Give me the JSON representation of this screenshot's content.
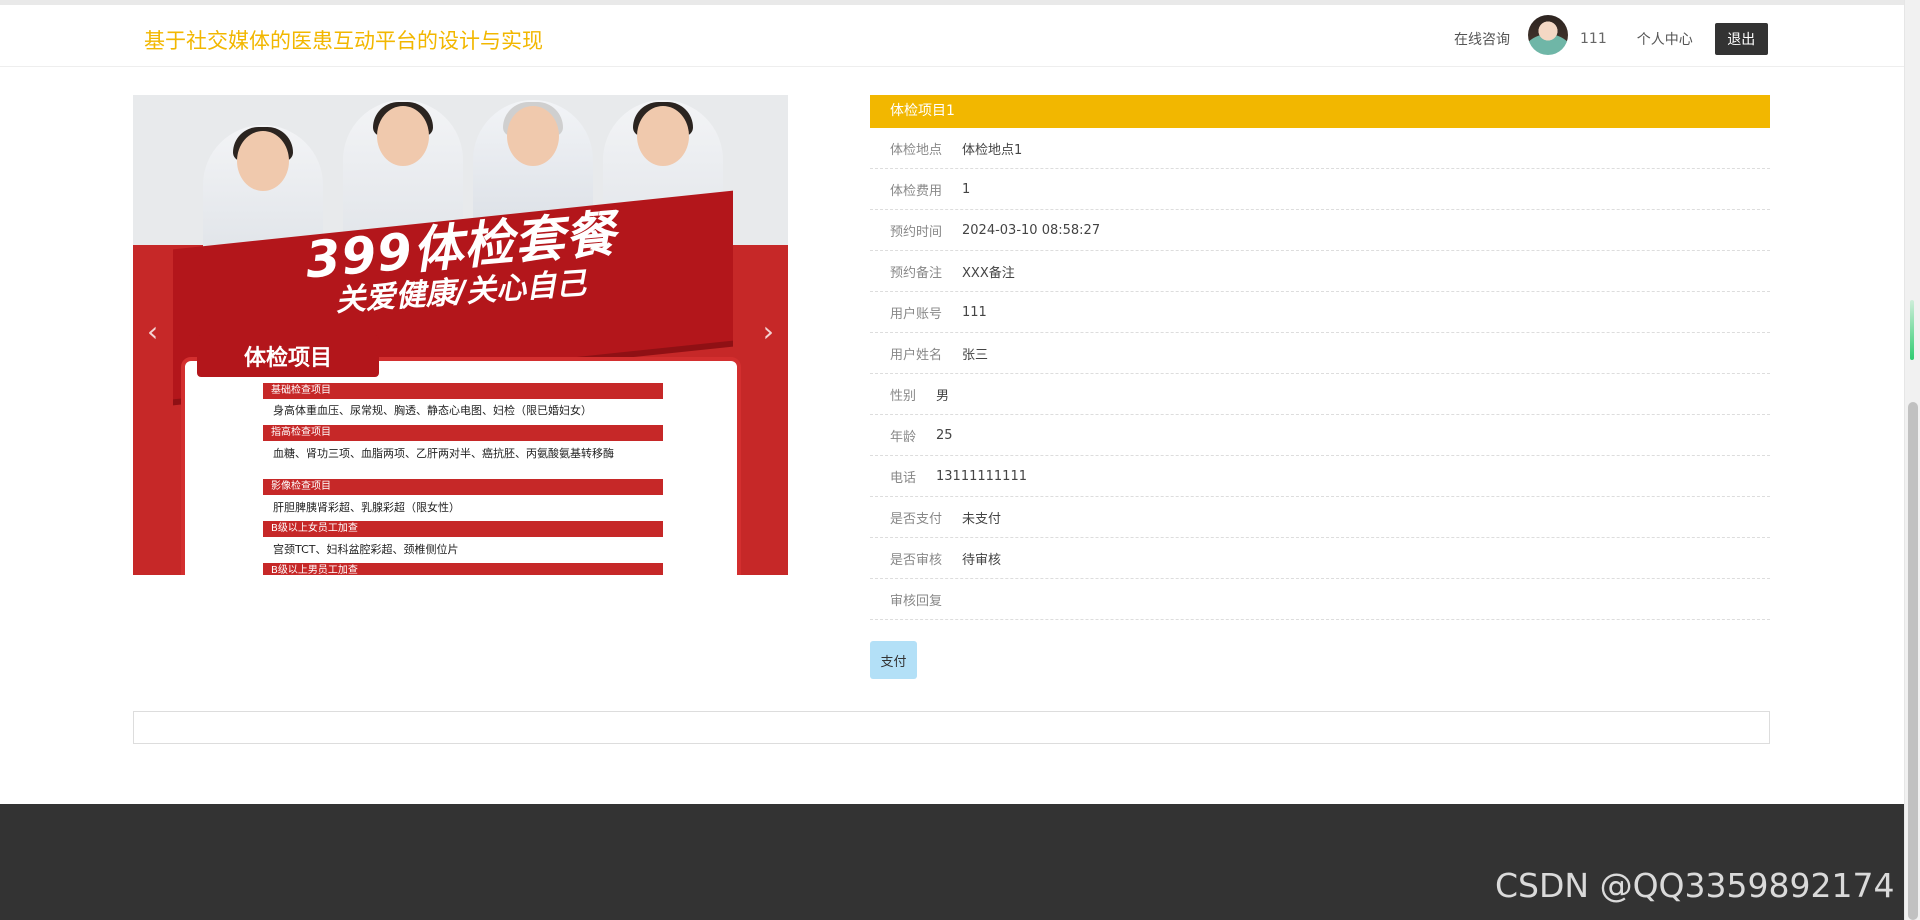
{
  "header": {
    "site_title": "基于社交媒体的医患互动平台的设计与实现",
    "nav": {
      "consult": "在线咨询",
      "username": "111",
      "profile": "个人中心",
      "logout": "退出"
    }
  },
  "carousel": {
    "poster_title": "399体检套餐",
    "poster_subtitle": "关爱健康/关心自己",
    "card_tab": "体检项目",
    "sections": [
      {
        "title": "基础检查项目",
        "content": "身高体重血压、尿常规、胸透、静态心电图、妇检（限已婚妇女）"
      },
      {
        "title": "指高检查项目",
        "content": "血糖、肾功三项、血脂两项、乙肝两对半、癌抗胚、丙氨酸氨基转移酶"
      },
      {
        "title": "影像检查项目",
        "content": "肝胆脾胰肾彩超、乳腺彩超（限女性）"
      },
      {
        "title": "B级以上女员工加查",
        "content": "宫颈TCT、妇科盆腔彩超、颈椎侧位片"
      },
      {
        "title": "B级以上男员工加查",
        "content": ""
      }
    ],
    "prev_icon": "‹",
    "next_icon": "›"
  },
  "detail": {
    "title": "体检项目1",
    "rows": [
      {
        "label": "体检地点",
        "value": "体检地点1"
      },
      {
        "label": "体检费用",
        "value": "1"
      },
      {
        "label": "预约时间",
        "value": "2024-03-10 08:58:27"
      },
      {
        "label": "预约备注",
        "value": "XXX备注"
      },
      {
        "label": "用户账号",
        "value": "111"
      },
      {
        "label": "用户姓名",
        "value": "张三"
      },
      {
        "label": "性别",
        "value": "男"
      },
      {
        "label": "年龄",
        "value": "25"
      },
      {
        "label": "电话",
        "value": "13111111111"
      },
      {
        "label": "是否支付",
        "value": "未支付"
      },
      {
        "label": "是否审核",
        "value": "待审核"
      },
      {
        "label": "审核回复",
        "value": ""
      }
    ],
    "pay_button": "支付"
  },
  "watermark": "CSDN @QQ3359892174",
  "colors": {
    "accent": "#f2b700",
    "footer": "#333333",
    "pay_button": "#b3e0f7"
  }
}
